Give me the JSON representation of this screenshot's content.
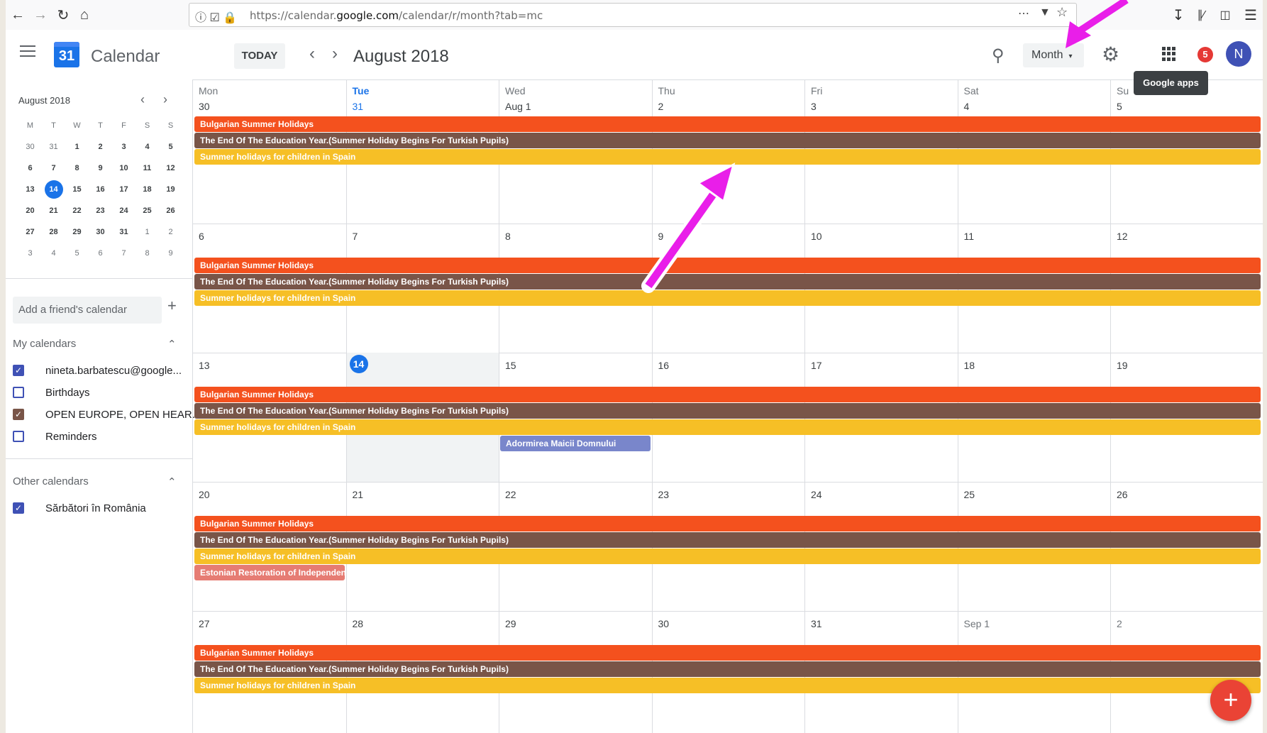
{
  "browser": {
    "url_prefix": "https://calendar.",
    "url_domain": "google.com",
    "url_suffix": "/calendar/r/month?tab=mc"
  },
  "header": {
    "app_name": "Calendar",
    "logo_day": "31",
    "today_label": "TODAY",
    "current_period": "August 2018",
    "view_label": "Month",
    "notification_count": "5",
    "avatar_initial": "N",
    "tooltip": "Google apps"
  },
  "minical": {
    "title": "August 2018",
    "weekday_headers": [
      "M",
      "T",
      "W",
      "T",
      "F",
      "S",
      "S"
    ],
    "weeks": [
      [
        "30",
        "31",
        "1",
        "2",
        "3",
        "4",
        "5"
      ],
      [
        "6",
        "7",
        "8",
        "9",
        "10",
        "11",
        "12"
      ],
      [
        "13",
        "14",
        "15",
        "16",
        "17",
        "18",
        "19"
      ],
      [
        "20",
        "21",
        "22",
        "23",
        "24",
        "25",
        "26"
      ],
      [
        "27",
        "28",
        "29",
        "30",
        "31",
        "1",
        "2"
      ],
      [
        "3",
        "4",
        "5",
        "6",
        "7",
        "8",
        "9"
      ]
    ],
    "selected": "14"
  },
  "sidebar": {
    "add_friend_placeholder": "Add a friend's calendar",
    "my_calendars_label": "My calendars",
    "my_calendars": [
      {
        "label": "nineta.barbatescu@google...",
        "checked": true,
        "color": "#3f51b5"
      },
      {
        "label": "Birthdays",
        "checked": false,
        "color": "#3f51b5"
      },
      {
        "label": "OPEN EUROPE, OPEN HEAR...",
        "checked": true,
        "color": "#795548"
      },
      {
        "label": "Reminders",
        "checked": false,
        "color": "#3f51b5"
      }
    ],
    "other_calendars_label": "Other calendars",
    "other_calendars": [
      {
        "label": "Sărbători în România",
        "checked": true,
        "color": "#3f51b5"
      }
    ]
  },
  "grid": {
    "day_names": [
      "Mon",
      "Tue",
      "Wed",
      "Thu",
      "Fri",
      "Sat",
      "Su"
    ],
    "weeks": [
      {
        "days": [
          "30",
          "31",
          "Aug 1",
          "2",
          "3",
          "4",
          "5"
        ]
      },
      {
        "days": [
          "6",
          "7",
          "8",
          "9",
          "10",
          "11",
          "12"
        ]
      },
      {
        "days": [
          "13",
          "14",
          "15",
          "16",
          "17",
          "18",
          "19"
        ]
      },
      {
        "days": [
          "20",
          "21",
          "22",
          "23",
          "24",
          "25",
          "26"
        ]
      },
      {
        "days": [
          "27",
          "28",
          "29",
          "30",
          "31",
          "Sep 1",
          "2"
        ]
      }
    ],
    "events": {
      "bulgarian": "Bulgarian Summer Holidays",
      "turkish": "The End Of The Education Year.(Summer Holiday Begins For Turkish Pupils)",
      "spain": "Summer holidays for children in Spain",
      "adormirea": "Adormirea Maicii Domnului",
      "estonian": "Estonian Restoration of Independence"
    }
  },
  "colors": {
    "bulgarian": "#f4511e",
    "turkish": "#795548",
    "spain": "#f6bf26",
    "adormirea": "#7986cb",
    "estonian": "#e67c73",
    "annotation_arrow": "#e91ee9"
  }
}
